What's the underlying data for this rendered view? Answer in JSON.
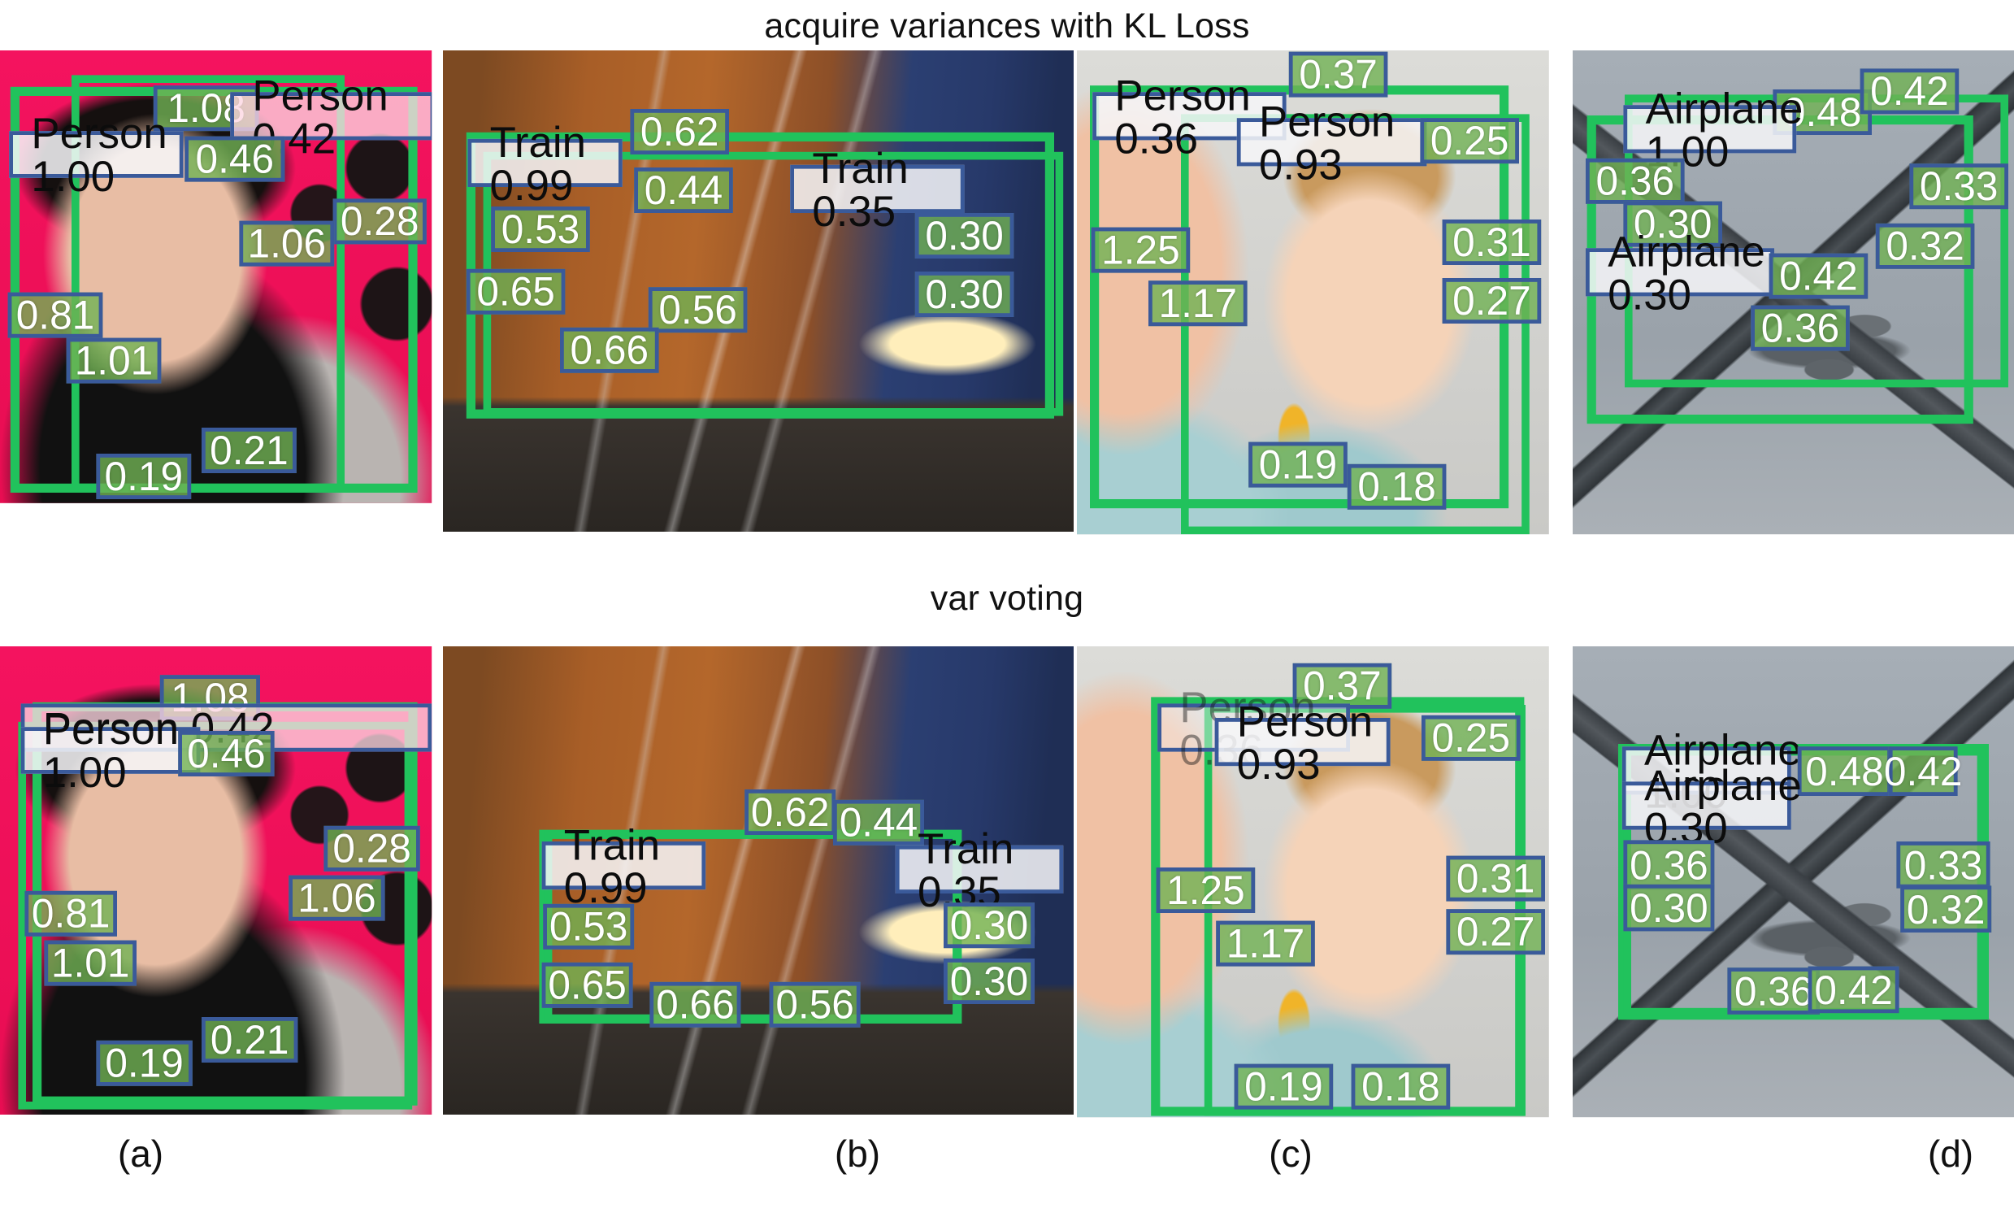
{
  "figure": {
    "row_titles": {
      "top": "acquire variances with KL Loss",
      "bottom": "var voting"
    },
    "captions": [
      "(a)",
      "(b)",
      "(c)",
      "(d)"
    ],
    "colors": {
      "detection_box": "#21c25c",
      "score_box_fill": "#70b254",
      "score_box_border": "#3a5a9a",
      "label_box_fill": "#f6f6f8",
      "score_text": "#ffffff",
      "label_text": "#0c0c0c"
    }
  },
  "panels": {
    "top": {
      "a": {
        "scene": "person-with-hat-on-pink-background",
        "labels": [
          "Person 1.00",
          "Person 0.42"
        ],
        "scores": [
          "1.08",
          "0.46",
          "0.28",
          "1.06",
          "0.81",
          "1.01",
          "0.19",
          "0.21"
        ]
      },
      "b": {
        "scene": "train-on-railway-tracks",
        "labels": [
          "Train 0.99",
          "Train 0.35"
        ],
        "scores": [
          "0.62",
          "0.44",
          "0.53",
          "0.65",
          "0.30",
          "0.30",
          "0.56",
          "0.66"
        ]
      },
      "c": {
        "scene": "woman-holding-baby-with-toothbrush",
        "labels": [
          "Person 0.36",
          "Person 0.93"
        ],
        "scores": [
          "0.37",
          "0.25",
          "1.25",
          "1.17",
          "0.31",
          "0.27",
          "0.19",
          "0.18"
        ]
      },
      "d": {
        "scene": "airplane-in-flight",
        "labels": [
          "Airplane 1.00",
          "Airplane 0.30"
        ],
        "scores": [
          "0.48",
          "0.42",
          "0.36",
          "0.30",
          "0.33",
          "0.32",
          "0.42",
          "0.36"
        ]
      }
    },
    "bottom": {
      "a": {
        "scene": "person-with-hat-on-pink-background",
        "labels": [
          "Person 1.00",
          "Person 0.42"
        ],
        "scores": [
          "1.08",
          "0.46",
          "0.28",
          "1.06",
          "0.81",
          "1.01",
          "0.19",
          "0.21"
        ]
      },
      "b": {
        "scene": "train-on-railway-tracks",
        "labels": [
          "Train 0.99",
          "Train 0.35"
        ],
        "scores": [
          "0.62",
          "0.44",
          "0.53",
          "0.65",
          "0.30",
          "0.30",
          "0.66",
          "0.56"
        ]
      },
      "c": {
        "scene": "woman-holding-baby-with-toothbrush",
        "labels": [
          "Person 0.36",
          "Person 0.93"
        ],
        "scores": [
          "0.37",
          "0.25",
          "1.25",
          "1.17",
          "0.31",
          "0.27",
          "0.19",
          "0.18"
        ]
      },
      "d": {
        "scene": "airplane-in-flight",
        "labels": [
          "Airplane 1.00",
          "Airplane 0.30"
        ],
        "scores": [
          "0.48",
          "0.42",
          "0.36",
          "0.30",
          "0.33",
          "0.32",
          "0.36",
          "0.42"
        ]
      }
    }
  }
}
